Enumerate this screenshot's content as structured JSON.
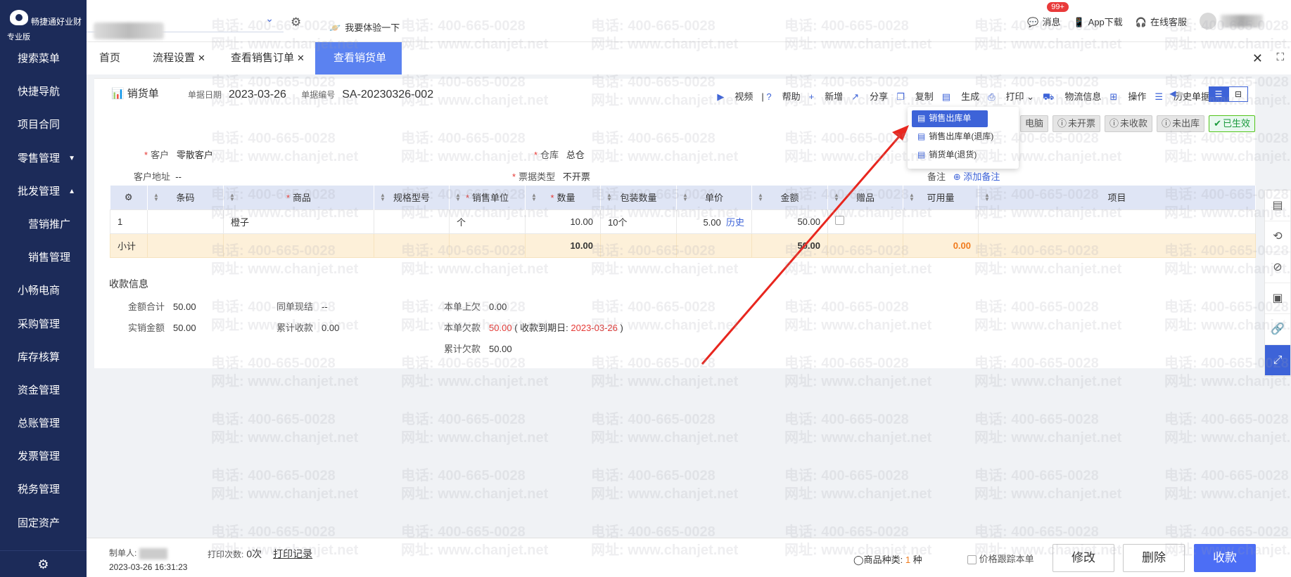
{
  "sidebar": {
    "brand": "畅捷通好业财",
    "edition": "专业版",
    "items": [
      {
        "label": "搜索菜单"
      },
      {
        "label": "快捷导航"
      },
      {
        "label": "项目合同"
      },
      {
        "label": "零售管理",
        "caret": "▼"
      },
      {
        "label": "批发管理",
        "caret": "▲"
      },
      {
        "label": "营销推广"
      },
      {
        "label": "销售管理"
      },
      {
        "label": "小畅电商"
      },
      {
        "label": "采购管理"
      },
      {
        "label": "库存核算"
      },
      {
        "label": "资金管理"
      },
      {
        "label": "总账管理"
      },
      {
        "label": "发票管理"
      },
      {
        "label": "税务管理"
      },
      {
        "label": "固定资产"
      }
    ]
  },
  "header": {
    "try_label": "我要体验一下",
    "messages_label": "消息",
    "messages_badge": "99+",
    "app_label": "App下载",
    "service_label": "在线客服"
  },
  "tabs": [
    {
      "label": "首页"
    },
    {
      "label": "流程设置"
    },
    {
      "label": "查看销售订单"
    },
    {
      "label": "查看销货单"
    }
  ],
  "doc": {
    "tab_label": "销货单",
    "date_label": "单据日期",
    "date_value": "2023-03-26",
    "no_label": "单据编号",
    "no_value": "SA-20230326-002"
  },
  "toolbar": {
    "video": "视频",
    "help": "帮助",
    "add": "新增",
    "share": "分享",
    "copy": "复制",
    "generate": "生成",
    "print": "打印",
    "logistics": "物流信息",
    "ops": "操作",
    "history": "历史单据"
  },
  "dropdown": [
    "销售出库单",
    "销售出库单(退库)",
    "销货单(退货)"
  ],
  "statuses": [
    {
      "label": "电脑",
      "ok": false
    },
    {
      "label": "未开票",
      "ok": false
    },
    {
      "label": "未收款",
      "ok": false
    },
    {
      "label": "未出库",
      "ok": false
    },
    {
      "label": "已生效",
      "ok": true
    }
  ],
  "form": {
    "customer_label": "客户",
    "customer_value": "零散客户",
    "warehouse_label": "仓库",
    "warehouse_value": "总仓",
    "address_label": "客户地址",
    "address_value": "--",
    "invoice_label": "票据类型",
    "invoice_value": "不开票",
    "remark_label": "备注",
    "add_remark": "添加备注"
  },
  "table": {
    "headers": [
      "条码",
      "商品",
      "规格型号",
      "销售单位",
      "数量",
      "包装数量",
      "单价",
      "金额",
      "赠品",
      "可用量",
      "项目"
    ],
    "row": {
      "index": "1",
      "barcode": "",
      "product": "橙子",
      "spec": "",
      "unit": "个",
      "qty": "10.00",
      "pack": "10个",
      "price": "5.00",
      "history": "历史",
      "amount": "50.00",
      "avail": "",
      "project": ""
    },
    "subtotal": {
      "label": "小计",
      "qty": "10.00",
      "amount": "50.00",
      "avail": "0.00"
    }
  },
  "payment": {
    "title": "收款信息",
    "total_label": "金额合计",
    "total_value": "50.00",
    "same_label": "同单现结",
    "same_value": "--",
    "prev_label": "本单上欠",
    "prev_value": "0.00",
    "actual_label": "实销金额",
    "actual_value": "50.00",
    "cum_label": "累计收款",
    "cum_value": "0.00",
    "owe_label": "本单欠款",
    "owe_value": "50.00",
    "due_prefix": "( 收款到期日:",
    "due_date": "2023-03-26",
    "due_suffix": ")",
    "cum_owe_label": "累计欠款",
    "cum_owe_value": "50.00"
  },
  "footer": {
    "maker_label": "制单人:",
    "time": "2023-03-26 16:31:23",
    "print_label": "打印次数:",
    "print_value": "0次",
    "print_record": "打印记录",
    "kind_label": "商品种类:",
    "kind_value": "1",
    "kind_unit": "种",
    "track_label": "价格跟踪本单",
    "edit": "修改",
    "delete": "删除",
    "collect": "收款"
  },
  "watermark": {
    "phone": "电话: 400-665-0028",
    "site": "网址: www.chanjet.net"
  },
  "colors": {
    "sidebar": "#1c2b59",
    "accent": "#3d63d8",
    "active_tab": "#5b82f0",
    "danger": "#e53935"
  }
}
